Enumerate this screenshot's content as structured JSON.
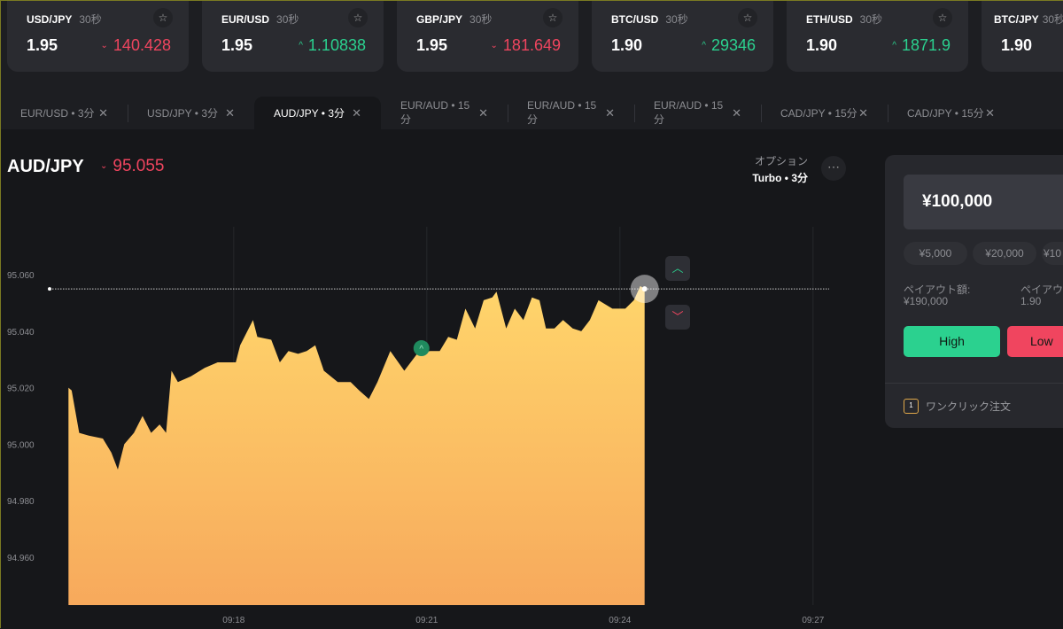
{
  "tickers": [
    {
      "symbol": "USD/JPY",
      "period": "30秒",
      "payout": "1.95",
      "price": "140.428",
      "direction": "down"
    },
    {
      "symbol": "EUR/USD",
      "period": "30秒",
      "payout": "1.95",
      "price": "1.10838",
      "direction": "up"
    },
    {
      "symbol": "GBP/JPY",
      "period": "30秒",
      "payout": "1.95",
      "price": "181.649",
      "direction": "down"
    },
    {
      "symbol": "BTC/USD",
      "period": "30秒",
      "payout": "1.90",
      "price": "29346",
      "direction": "up"
    },
    {
      "symbol": "ETH/USD",
      "period": "30秒",
      "payout": "1.90",
      "price": "1871.9",
      "direction": "up"
    },
    {
      "symbol": "BTC/JPY",
      "period": "30秒",
      "payout": "1.90",
      "price": "",
      "direction": ""
    }
  ],
  "tabs": [
    {
      "label": "EUR/USD • 3分",
      "active": false
    },
    {
      "label": "USD/JPY • 3分",
      "active": false
    },
    {
      "label": "AUD/JPY • 3分",
      "active": true
    },
    {
      "label": "EUR/AUD • 15分",
      "active": false
    },
    {
      "label": "EUR/AUD • 15分",
      "active": false
    },
    {
      "label": "EUR/AUD • 15分",
      "active": false
    },
    {
      "label": "CAD/JPY • 15分",
      "active": false
    },
    {
      "label": "CAD/JPY • 15分",
      "active": false
    }
  ],
  "asset": {
    "symbol": "AUD/JPY",
    "price": "95.055",
    "direction": "down"
  },
  "option": {
    "label": "オプション",
    "type": "Turbo • 3分"
  },
  "panel": {
    "amount": "¥100,000",
    "chips": [
      "¥5,000",
      "¥20,000",
      "¥10"
    ],
    "payout_label": "ペイアウト額:",
    "payout_value": "¥190,000",
    "rate_label": "ペイアウ",
    "rate_value": "1.90",
    "high": "High",
    "low": "Low",
    "one_click": "ワンクリック注文",
    "one_click_icon_text": "1"
  },
  "colors": {
    "up": "#2bd18f",
    "down": "#f0455f",
    "area_top": "#ffd56b",
    "area_bottom": "#f7a95c"
  },
  "chart_data": {
    "type": "area",
    "xlabel": "",
    "ylabel": "",
    "xlim": [
      "09:14:23",
      "09:27:15"
    ],
    "ylim": [
      94.943,
      95.077
    ],
    "yticks": [
      "94.960",
      "94.980",
      "95.000",
      "95.020",
      "95.040",
      "95.060"
    ],
    "xticks": [
      "09:18",
      "09:21",
      "09:24",
      "09:27"
    ],
    "grid": "vertical",
    "current_price": 95.055,
    "trade_marker": {
      "time": "09:20:55",
      "price": 95.034,
      "direction": "up"
    },
    "points": [
      [
        "09:15:26",
        95.02
      ],
      [
        "09:15:29",
        95.019
      ],
      [
        "09:15:36",
        95.004
      ],
      [
        "09:15:45",
        95.003
      ],
      [
        "09:15:58",
        95.002
      ],
      [
        "09:16:06",
        94.997
      ],
      [
        "09:16:12",
        94.991
      ],
      [
        "09:16:18",
        95.0
      ],
      [
        "09:16:27",
        95.004
      ],
      [
        "09:16:35",
        95.01
      ],
      [
        "09:16:43",
        95.004
      ],
      [
        "09:16:51",
        95.007
      ],
      [
        "09:16:57",
        95.004
      ],
      [
        "09:17:02",
        95.026
      ],
      [
        "09:17:08",
        95.022
      ],
      [
        "09:17:20",
        95.024
      ],
      [
        "09:17:33",
        95.027
      ],
      [
        "09:17:45",
        95.029
      ],
      [
        "09:18:02",
        95.029
      ],
      [
        "09:18:06",
        95.035
      ],
      [
        "09:18:18",
        95.044
      ],
      [
        "09:18:22",
        95.038
      ],
      [
        "09:18:35",
        95.037
      ],
      [
        "09:18:43",
        95.029
      ],
      [
        "09:18:51",
        95.033
      ],
      [
        "09:19:00",
        95.032
      ],
      [
        "09:19:08",
        95.033
      ],
      [
        "09:19:16",
        95.035
      ],
      [
        "09:19:24",
        95.026
      ],
      [
        "09:19:37",
        95.022
      ],
      [
        "09:19:49",
        95.022
      ],
      [
        "09:19:57",
        95.019
      ],
      [
        "09:20:06",
        95.016
      ],
      [
        "09:20:14",
        95.022
      ],
      [
        "09:20:26",
        95.033
      ],
      [
        "09:20:39",
        95.026
      ],
      [
        "09:20:51",
        95.032
      ],
      [
        "09:21:03",
        95.033
      ],
      [
        "09:21:12",
        95.033
      ],
      [
        "09:21:20",
        95.038
      ],
      [
        "09:21:28",
        95.037
      ],
      [
        "09:21:36",
        95.048
      ],
      [
        "09:21:45",
        95.041
      ],
      [
        "09:21:53",
        95.051
      ],
      [
        "09:22:01",
        95.052
      ],
      [
        "09:22:05",
        95.054
      ],
      [
        "09:22:14",
        95.041
      ],
      [
        "09:22:22",
        95.048
      ],
      [
        "09:22:30",
        95.044
      ],
      [
        "09:22:38",
        95.052
      ],
      [
        "09:22:45",
        95.051
      ],
      [
        "09:22:51",
        95.041
      ],
      [
        "09:22:59",
        95.041
      ],
      [
        "09:23:07",
        95.044
      ],
      [
        "09:23:16",
        95.041
      ],
      [
        "09:23:24",
        95.04
      ],
      [
        "09:23:32",
        95.044
      ],
      [
        "09:23:40",
        95.051
      ],
      [
        "09:23:53",
        95.048
      ],
      [
        "09:24:05",
        95.048
      ],
      [
        "09:24:13",
        95.051
      ],
      [
        "09:24:19",
        95.056
      ],
      [
        "09:24:23",
        95.055
      ]
    ]
  }
}
